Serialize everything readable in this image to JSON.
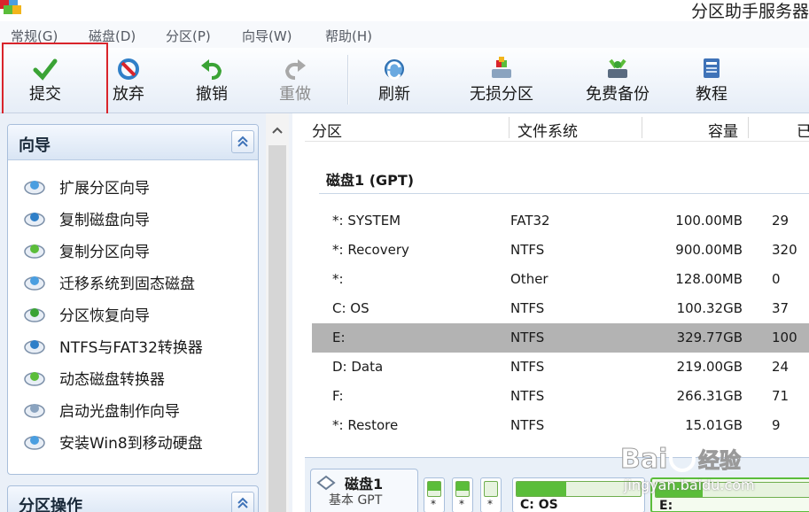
{
  "window": {
    "title": "分区助手服务器"
  },
  "menu": [
    "常规(G)",
    "磁盘(D)",
    "分区(P)",
    "向导(W)",
    "帮助(H)"
  ],
  "toolbar": {
    "submit": "提交",
    "discard": "放弃",
    "undo": "撤销",
    "redo": "重做",
    "refresh": "刷新",
    "lossless": "无损分区",
    "backup": "免费备份",
    "tutorial": "教程"
  },
  "wizard_panel": {
    "title": "向导",
    "items": [
      {
        "label": "扩展分区向导",
        "icon": "extend-partition-icon"
      },
      {
        "label": "复制磁盘向导",
        "icon": "copy-disk-icon"
      },
      {
        "label": "复制分区向导",
        "icon": "copy-partition-icon"
      },
      {
        "label": "迁移系统到固态磁盘",
        "icon": "migrate-os-icon"
      },
      {
        "label": "分区恢复向导",
        "icon": "partition-recovery-icon"
      },
      {
        "label": "NTFS与FAT32转换器",
        "icon": "ntfs-fat32-icon"
      },
      {
        "label": "动态磁盘转换器",
        "icon": "dynamic-disk-icon"
      },
      {
        "label": "启动光盘制作向导",
        "icon": "boot-cd-icon"
      },
      {
        "label": "安装Win8到移动硬盘",
        "icon": "win8-to-go-icon"
      }
    ]
  },
  "ops_panel": {
    "title": "分区操作"
  },
  "table": {
    "headers": [
      "分区",
      "文件系统",
      "容量",
      "已"
    ],
    "disk_label": "磁盘1 (GPT)",
    "rows": [
      {
        "name": "*: SYSTEM",
        "fs": "FAT32",
        "cap": "100.00MB",
        "used": "29"
      },
      {
        "name": "*: Recovery",
        "fs": "NTFS",
        "cap": "900.00MB",
        "used": "320"
      },
      {
        "name": "*:",
        "fs": "Other",
        "cap": "128.00MB",
        "used": "0"
      },
      {
        "name": "C: OS",
        "fs": "NTFS",
        "cap": "100.32GB",
        "used": "37"
      },
      {
        "name": "E:",
        "fs": "NTFS",
        "cap": "329.77GB",
        "used": "100"
      },
      {
        "name": "D: Data",
        "fs": "NTFS",
        "cap": "219.00GB",
        "used": "24"
      },
      {
        "name": "F:",
        "fs": "NTFS",
        "cap": "266.31GB",
        "used": "71"
      },
      {
        "name": "*: Restore",
        "fs": "NTFS",
        "cap": "15.01GB",
        "used": "9"
      }
    ],
    "selected_row": 4
  },
  "disk_map": {
    "disk_name": "磁盘1",
    "disk_type": "基本 GPT",
    "small_parts": [
      {
        "label": "*",
        "fill": 0.6
      },
      {
        "label": "*",
        "fill": 0.6
      },
      {
        "label": "*",
        "fill": 0.0
      }
    ],
    "big_parts": [
      {
        "label": "C: OS",
        "fill": 0.4,
        "selected": false
      },
      {
        "label": "E:",
        "fill": 0.3,
        "selected": true
      }
    ]
  },
  "watermark": {
    "brand": "Baidu经验",
    "url": "jingyan.baidu.com"
  },
  "colors": {
    "accent_green": "#5bbd3a",
    "selection_red": "#d9242b",
    "row_selected": "#b3b3b3"
  }
}
